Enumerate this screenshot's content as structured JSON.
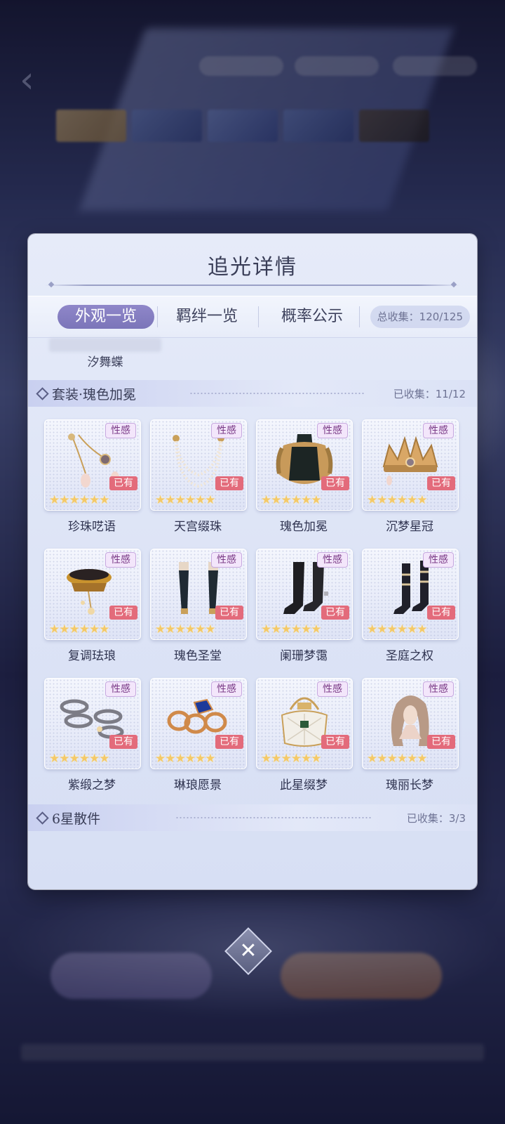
{
  "background": {
    "back_icon": "chevron-left-icon"
  },
  "panel": {
    "title": "追光详情",
    "tabs": [
      {
        "label": "外观一览",
        "active": true
      },
      {
        "label": "羁绊一览",
        "active": false
      },
      {
        "label": "概率公示",
        "active": false
      }
    ],
    "total_collect": "总收集：120/125",
    "previous_item": "汐舞蝶",
    "sections": [
      {
        "name": "套装·瑰色加冕",
        "count": "已收集：11/12",
        "items": [
          {
            "name": "珍珠呓语",
            "tag": "性感",
            "owned": "已有",
            "stars": "★★★★★★",
            "icon": "pearl-earrings-icon"
          },
          {
            "name": "天宫缀珠",
            "tag": "性感",
            "owned": "已有",
            "stars": "★★★★★★",
            "icon": "pearl-chain-icon"
          },
          {
            "name": "瑰色加冕",
            "tag": "性感",
            "owned": "已有",
            "stars": "★★★★★★",
            "icon": "gown-icon"
          },
          {
            "name": "沉梦星冠",
            "tag": "性感",
            "owned": "已有",
            "stars": "★★★★★★",
            "icon": "crown-icon"
          },
          {
            "name": "复调珐琅",
            "tag": "性感",
            "owned": "已有",
            "stars": "★★★★★★",
            "icon": "choker-icon"
          },
          {
            "name": "瑰色圣堂",
            "tag": "性感",
            "owned": "已有",
            "stars": "★★★★★★",
            "icon": "gloves-icon"
          },
          {
            "name": "阑珊梦霭",
            "tag": "性感",
            "owned": "已有",
            "stars": "★★★★★★",
            "icon": "stockings-icon"
          },
          {
            "name": "圣庭之权",
            "tag": "性感",
            "owned": "已有",
            "stars": "★★★★★★",
            "icon": "boots-icon"
          },
          {
            "name": "紫缎之梦",
            "tag": "性感",
            "owned": "已有",
            "stars": "★★★★★★",
            "icon": "bracelets-icon"
          },
          {
            "name": "琳琅愿景",
            "tag": "性感",
            "owned": "已有",
            "stars": "★★★★★★",
            "icon": "rings-icon"
          },
          {
            "name": "此星缀梦",
            "tag": "性感",
            "owned": "已有",
            "stars": "★★★★★★",
            "icon": "handbag-icon"
          },
          {
            "name": "瑰丽长梦",
            "tag": "性感",
            "owned": "已有",
            "stars": "★★★★★★",
            "icon": "hair-icon"
          }
        ]
      },
      {
        "name": "6星散件",
        "count": "已收集：3/3"
      }
    ],
    "close_icon": "close-icon",
    "close_glyph": "✕"
  }
}
